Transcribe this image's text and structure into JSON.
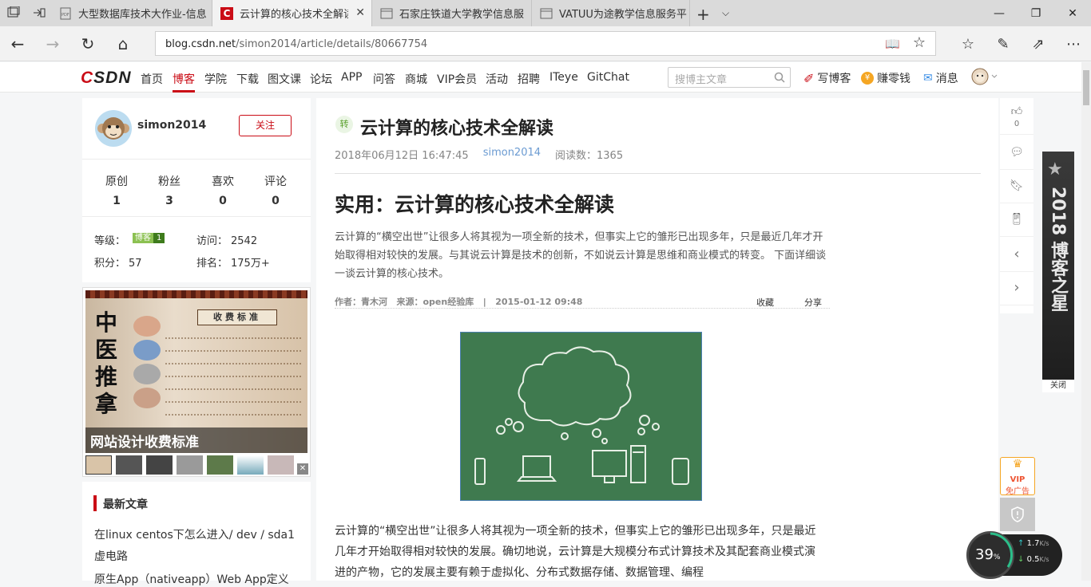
{
  "browser": {
    "tabs": [
      {
        "label": "大型数据库技术大作业-信息",
        "icon": "pdf-icon"
      },
      {
        "label": "云计算的核心技术全解读",
        "icon": "csdn-icon",
        "active": true
      },
      {
        "label": "石家庄铁道大学教学信息服",
        "icon": "page-icon"
      },
      {
        "label": "VATUU为途教学信息服务平",
        "icon": "page-icon"
      }
    ],
    "url_domain": "blog.csdn.net",
    "url_path": "/simon2014/article/details/80667754"
  },
  "csdn": {
    "logo": "CSDN",
    "nav": [
      "首页",
      "博客",
      "学院",
      "下载",
      "图文课",
      "论坛",
      "APP",
      "问答",
      "商城",
      "VIP会员",
      "活动",
      "招聘",
      "ITeye",
      "GitChat"
    ],
    "active_nav": "博客",
    "search_placeholder": "搜博主文章",
    "write": "写博客",
    "earn": "赚零钱",
    "messages": "消息"
  },
  "profile": {
    "name": "simon2014",
    "follow": "关注",
    "stats": [
      {
        "label": "原创",
        "value": "1"
      },
      {
        "label": "粉丝",
        "value": "3"
      },
      {
        "label": "喜欢",
        "value": "0"
      },
      {
        "label": "评论",
        "value": "0"
      }
    ],
    "level_label": "等级：",
    "level_badge": "博客",
    "level_num": "1",
    "visits_label": "访问：",
    "visits": "2542",
    "points_label": "积分：",
    "points": "57",
    "rank_label": "排名：",
    "rank": "175万+"
  },
  "left_ad": {
    "title": "网站设计收费标准",
    "table_title": "收费标准"
  },
  "recent": {
    "title": "最新文章",
    "items": [
      "在linux centos下怎么进入/ dev / sda1",
      "虚电路",
      "原生App（nativeapp）Web App定义"
    ]
  },
  "article": {
    "badge": "转",
    "title": "云计算的核心技术全解读",
    "date": "2018年06月12日 16:47:45",
    "author": "simon2014",
    "reads": "阅读数：1365",
    "heading": "实用：云计算的核心技术全解读",
    "intro": "云计算的“横空出世”让很多人将其视为一项全新的技术，但事实上它的雏形已出现多年，只是最近几年才开始取得相对较快的发展。与其说云计算是技术的创新，不如说云计算是思维和商业模式的转变。 下面详细谈一谈云计算的核心技术。",
    "meta": "作者：青木河   来源：open经验库   |   2015-01-12 09:48",
    "collect": "收藏",
    "share": "分享",
    "body": "云计算的“横空出世”让很多人将其视为一项全新的技术，但事实上它的雏形已出现多年，只是最近几年才开始取得相对较快的发展。确切地说，云计算是大规模分布式计算技术及其配套商业模式演进的产物，它的发展主要有赖于虚拟化、分布式数据存储、数据管理、编程"
  },
  "rail": {
    "likes": "0"
  },
  "side_ad": {
    "text": "2018 博客之星",
    "close": "关闭"
  },
  "vip": {
    "label": "VIP",
    "sub": "免广告"
  },
  "speed": {
    "percent": "39",
    "up": "1.7",
    "down": "0.5",
    "unit": "K/s"
  },
  "colors": {
    "accent": "#ca0c16",
    "link": "#6b9bd2",
    "chalkboard": "#3f7a4f"
  }
}
